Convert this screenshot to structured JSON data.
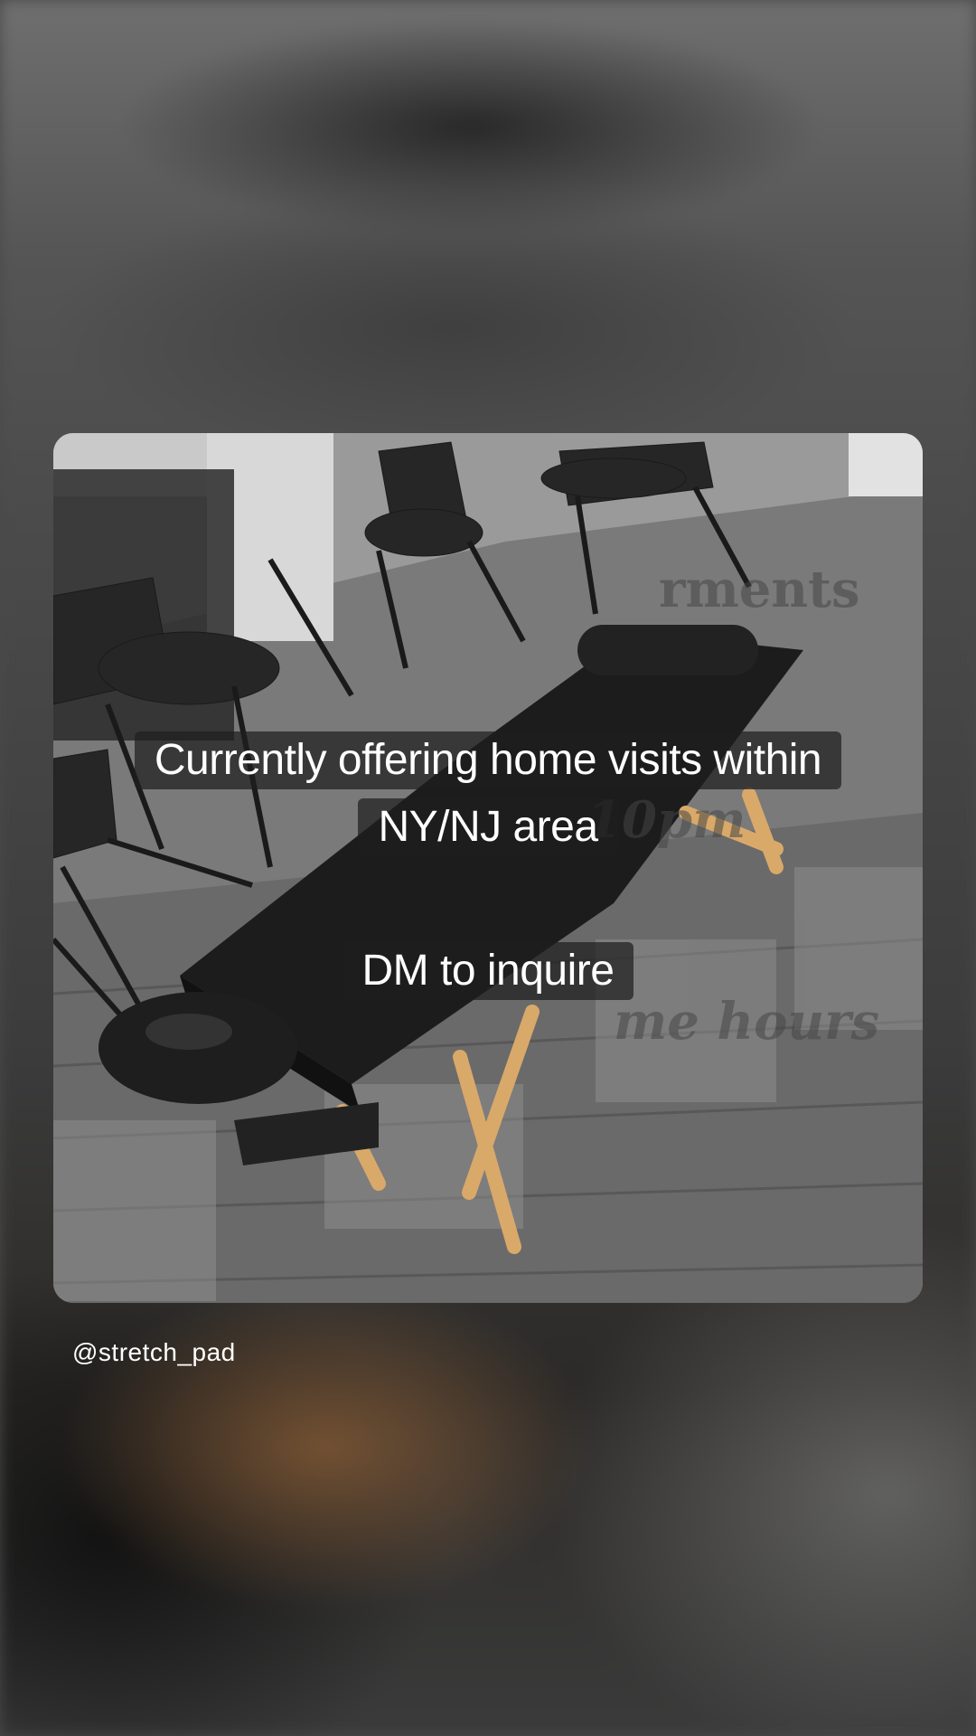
{
  "post": {
    "caption_line1": "Currently offering home visits within",
    "caption_line2": "NY/NJ area",
    "caption_cta": "DM to inquire",
    "username": "@stretch_pad"
  },
  "background_text": {
    "fragment_1": "rments",
    "fragment_2": "10pm",
    "fragment_3": "me hours"
  },
  "colors": {
    "caption_bg": "#1e1e1e",
    "caption_text": "#ffffff",
    "table": "#1c1c1c",
    "table_legs": "#d9a96a"
  }
}
